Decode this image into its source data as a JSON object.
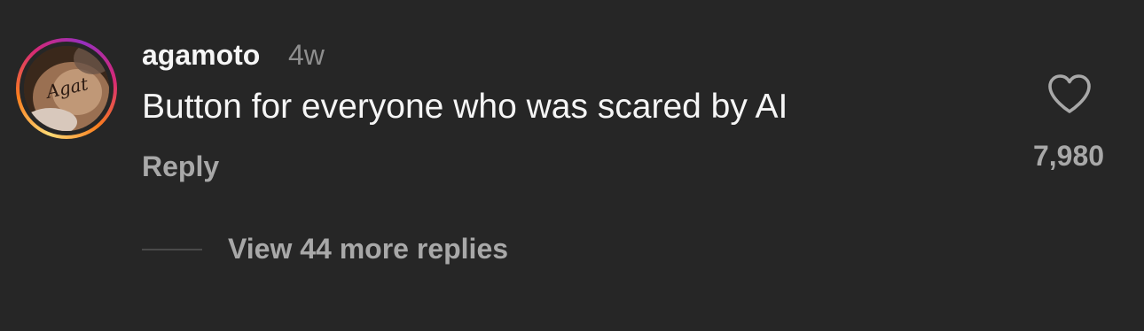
{
  "comment": {
    "username": "agamoto",
    "timestamp": "4w",
    "text": "Button for everyone who was scared by AI",
    "reply_label": "Reply",
    "like_count": "7,980",
    "view_replies_label": "View 44 more replies",
    "avatar_tattoo_text": "Agat",
    "icons": {
      "like": "heart-outline-icon"
    },
    "colors": {
      "background": "#262626",
      "primary_text": "#f5f5f5",
      "secondary_text": "#a8a8a8",
      "timestamp_text": "#8e8e8e",
      "story_ring_start": "#feda75",
      "story_ring_end": "#d62976"
    }
  }
}
